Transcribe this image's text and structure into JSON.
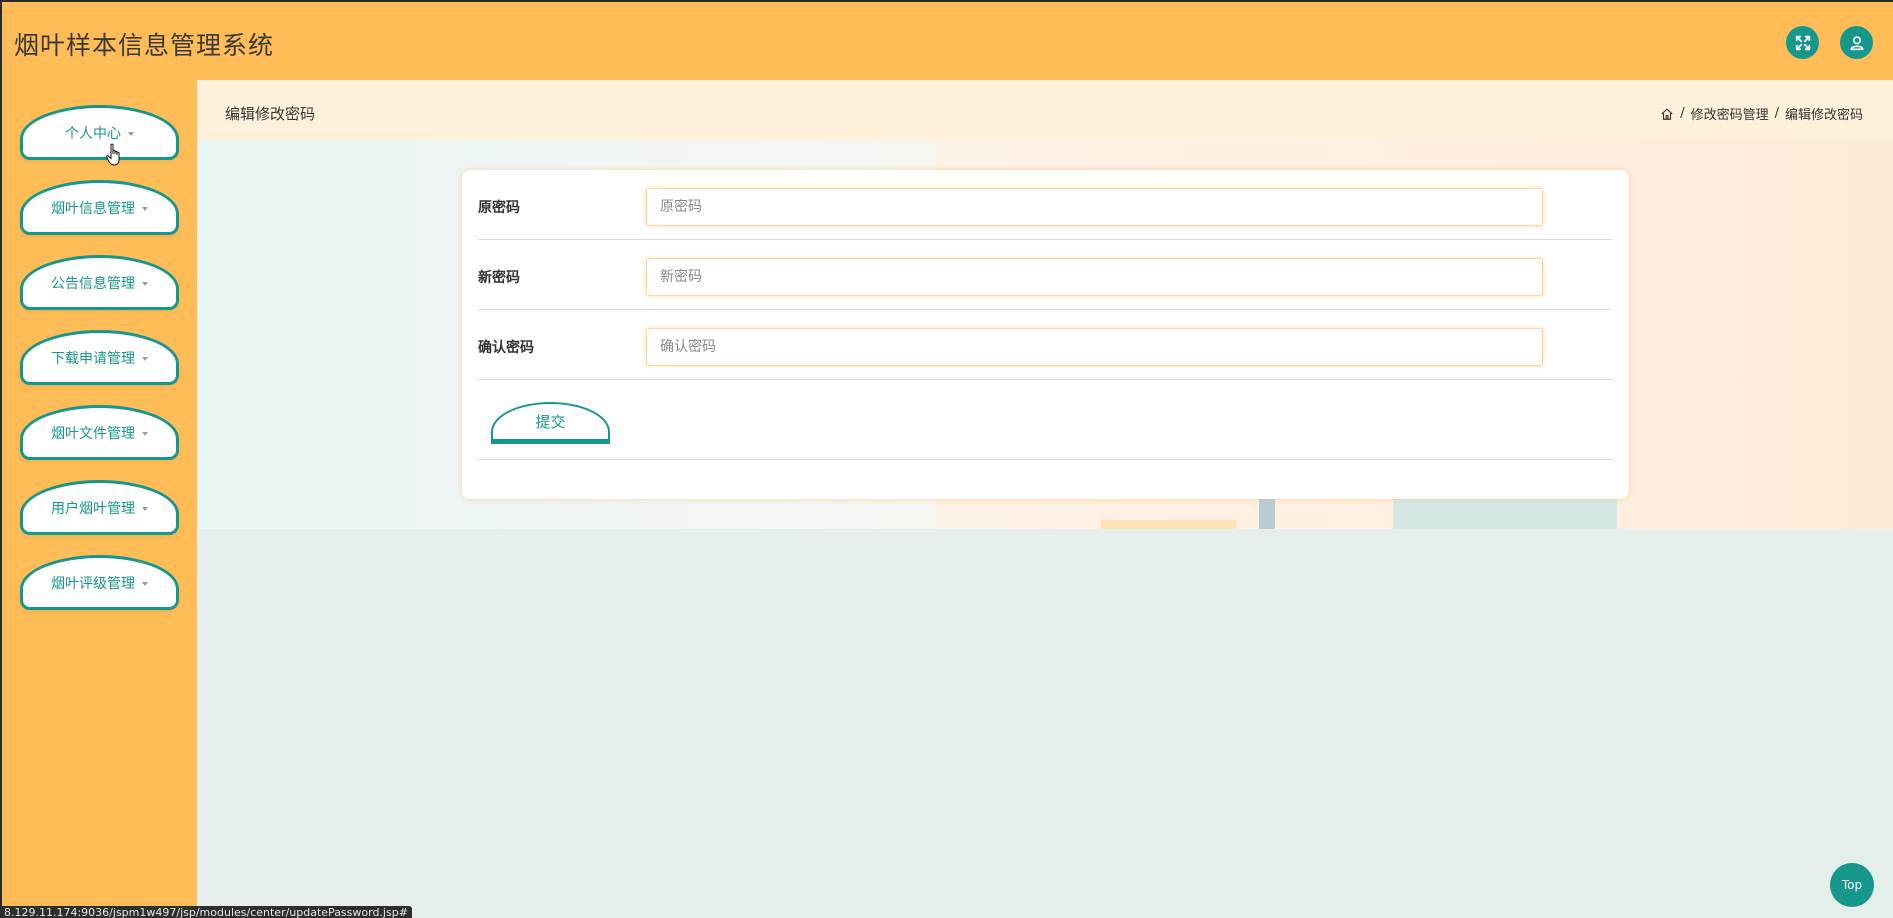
{
  "app": {
    "title": "烟叶样本信息管理系统"
  },
  "header": {
    "fullscreen_icon": "fullscreen-icon",
    "user_icon": "user-icon"
  },
  "sidebar": {
    "items": [
      {
        "label": "个人中心"
      },
      {
        "label": "烟叶信息管理"
      },
      {
        "label": "公告信息管理"
      },
      {
        "label": "下载申请管理"
      },
      {
        "label": "烟叶文件管理"
      },
      {
        "label": "用户烟叶管理"
      },
      {
        "label": "烟叶评级管理"
      }
    ]
  },
  "page": {
    "title": "编辑修改密码",
    "breadcrumb": [
      "修改密码管理",
      "编辑修改密码"
    ],
    "breadcrumb_separator": "/"
  },
  "form": {
    "fields": [
      {
        "label": "原密码",
        "placeholder": "原密码",
        "value": ""
      },
      {
        "label": "新密码",
        "placeholder": "新密码",
        "value": ""
      },
      {
        "label": "确认密码",
        "placeholder": "确认密码",
        "value": ""
      }
    ],
    "submit_label": "提交"
  },
  "status_bar": {
    "url": "8.129.11.174:9036/jspm1w497/jsp/modules/center/updatePassword.jsp#"
  },
  "top_button": {
    "label": "Top"
  },
  "colors": {
    "accent": "#16978b",
    "header_bg": "#ffbc57",
    "breadcrumb_bg": "#fff0da",
    "page_bg": "#e4efeb"
  }
}
